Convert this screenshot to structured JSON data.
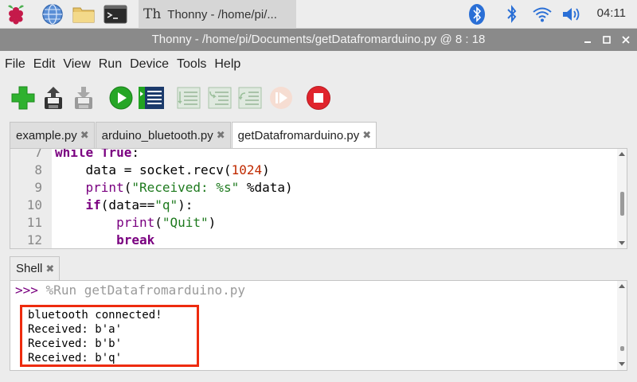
{
  "taskbar": {
    "launchers": [
      "raspberry-menu-icon",
      "globe-browser-icon",
      "folder-icon",
      "terminal-icon"
    ],
    "task_title": "Thonny  -  /home/pi/...",
    "tray_icons": [
      "bluetooth-bt-icon",
      "bluetooth-icon",
      "wifi-icon",
      "volume-icon"
    ],
    "clock": "04:11"
  },
  "window": {
    "title": "Thonny  -  /home/pi/Documents/getDatafromarduino.py  @  8 : 18"
  },
  "menu": [
    "File",
    "Edit",
    "View",
    "Run",
    "Device",
    "Tools",
    "Help"
  ],
  "toolbar": [
    "new-icon",
    "load-icon",
    "save-icon",
    "run-icon",
    "debug-icon",
    "step-over-icon",
    "step-into-icon",
    "step-out-icon",
    "resume-icon",
    "stop-icon"
  ],
  "editor": {
    "tabs": [
      {
        "label": "example.py",
        "close": "✖"
      },
      {
        "label": "arduino_bluetooth.py",
        "close": "✖"
      },
      {
        "label": "getDatafromarduino.py",
        "close": "✖",
        "active": true
      }
    ],
    "lines": [
      {
        "n": "7",
        "code": "while True:"
      },
      {
        "n": "8",
        "code": "    data = socket.recv(1024)"
      },
      {
        "n": "9",
        "code": "    print(\"Received: %s\" %data)"
      },
      {
        "n": "10",
        "code": "    if(data==\"q\"):"
      },
      {
        "n": "11",
        "code": "        print(\"Quit\")"
      },
      {
        "n": "12",
        "code": "        break"
      }
    ]
  },
  "shell": {
    "tab_label": "Shell",
    "tab_close": "✖",
    "prompt": ">>>",
    "command": "%Run getDatafromarduino.py",
    "output": [
      "bluetooth connected!",
      "Received: b'a'",
      "Received: b'b'",
      "Received: b'q'"
    ],
    "highlight_color": "#ee2b0e"
  }
}
